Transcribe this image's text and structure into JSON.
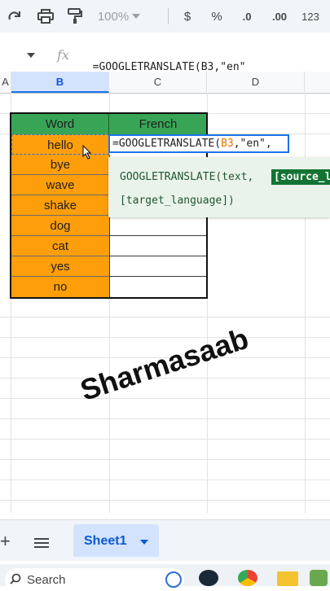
{
  "toolbar": {
    "zoom": "100%",
    "currency": "$",
    "percent": "%",
    "dec_decrease": ".0",
    "dec_increase": ".00",
    "number_format": "123"
  },
  "formula_bar": {
    "fx": "fx",
    "formula": "=GOOGLETRANSLATE(B3,\"en\""
  },
  "columns": [
    "A",
    "B",
    "C",
    "D"
  ],
  "table": {
    "headers": [
      "Word",
      "French"
    ],
    "words": [
      "hello",
      "bye",
      "wave",
      "shake",
      "dog",
      "cat",
      "yes",
      "no"
    ]
  },
  "editor": {
    "prefix": "=GOOGLETRANSLATE(",
    "ref": "B3",
    "suffix": ",\"en\","
  },
  "tooltip": {
    "line1": "GOOGLETRANSLATE(text,",
    "highlight": "[source_l",
    "line2": "[target_language])"
  },
  "watermark": "Sharmasaab",
  "sheets": {
    "add": "+",
    "active": "Sheet1"
  },
  "taskbar": {
    "search_placeholder": "Search"
  },
  "colors": {
    "header_green": "#38a556",
    "word_orange": "#ff9e0b",
    "selection_blue": "#1a73e8",
    "ref_orange": "#e37400"
  }
}
